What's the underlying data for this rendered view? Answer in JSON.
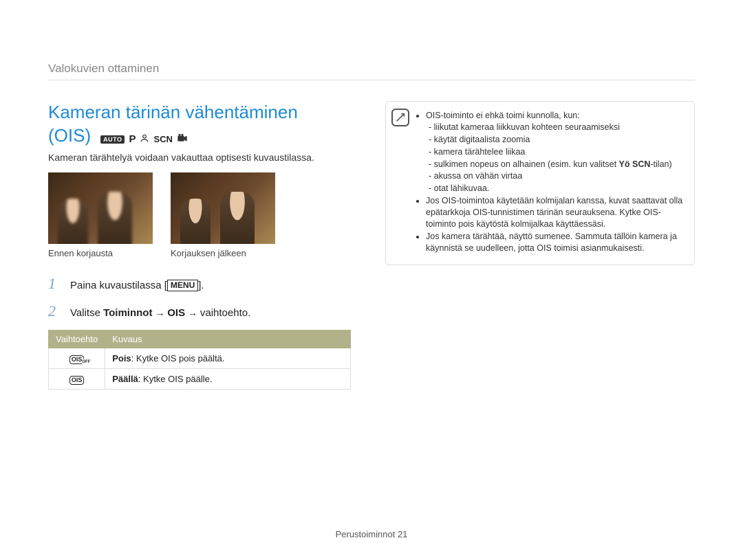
{
  "breadcrumb": "Valokuvien ottaminen",
  "title_line1": "Kameran tärinän vähentäminen",
  "title_line2": "(OIS)",
  "modes": {
    "auto": "AUTO",
    "p": "P",
    "scn": "SCN"
  },
  "intro": "Kameran tärähtelyä voidaan vakauttaa optisesti kuvaustilassa.",
  "photos": {
    "before": "Ennen korjausta",
    "after": "Korjauksen jälkeen"
  },
  "steps": {
    "s1_pre": "Paina kuvaustilassa [",
    "s1_key": "MENU",
    "s1_post": "].",
    "s2_pre": "Valitse ",
    "s2_b1": "Toiminnot",
    "s2_arrow": " → ",
    "s2_b2": "OIS",
    "s2_post": " vaihtoehto."
  },
  "table": {
    "h1": "Vaihtoehto",
    "h2": "Kuvaus",
    "r1_icon": "OIS",
    "r1_label": "Pois",
    "r1_desc": ": Kytke OIS pois päältä.",
    "r2_icon": "OIS",
    "r2_label": "Päällä",
    "r2_desc": ": Kytke OIS päälle."
  },
  "notes": {
    "n1": "OIS-toiminto ei ehkä toimi kunnolla, kun:",
    "n1a": "liikutat kameraa liikkuvan kohteen seuraamiseksi",
    "n1b": "käytät digitaalista zoomia",
    "n1c": "kamera tärähtelee liikaa",
    "n1d_pre": "sulkimen nopeus on alhainen (esim. kun valitset ",
    "n1d_mode": "Yö SCN",
    "n1d_post": "-tilan)",
    "n1e": "akussa on vähän virtaa",
    "n1f": "otat lähikuvaa.",
    "n2": "Jos OIS-toimintoa käytetään kolmijalan kanssa, kuvat saattavat olla epätarkkoja OIS-tunnistimen tärinän seurauksena. Kytke OIS-toiminto pois käytöstä kolmijalkaa käyttäessäsi.",
    "n3": "Jos kamera tärähtää, näyttö sumenee. Sammuta tällöin kamera ja käynnistä se uudelleen, jotta OIS toimisi asianmukaisesti."
  },
  "footer_label": "Perustoiminnot",
  "footer_page": "21"
}
